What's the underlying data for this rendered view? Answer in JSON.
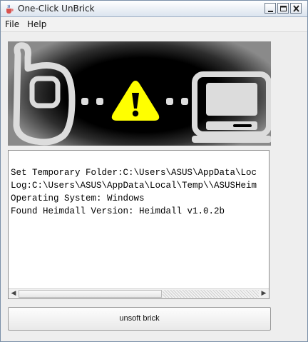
{
  "window": {
    "title": "One-Click UnBrick",
    "icon": "java-cup-icon",
    "controls": [
      "minimize",
      "maximize",
      "close"
    ]
  },
  "menubar": {
    "items": [
      {
        "label": "File"
      },
      {
        "label": "Help"
      }
    ]
  },
  "banner": {
    "icons": [
      "phone-icon",
      "warning-icon",
      "computer-icon"
    ],
    "warning_color": "#ffff00"
  },
  "log": {
    "lines": [
      "Set Temporary Folder:C:\\Users\\ASUS\\AppData\\Loc",
      "Log:C:\\Users\\ASUS\\AppData\\Local\\Temp\\\\ASUSHeim",
      "Operating System: Windows",
      "Found Heimdall Version: Heimdall v1.0.2b"
    ]
  },
  "actions": {
    "unsoft_label": "unsoft brick"
  }
}
